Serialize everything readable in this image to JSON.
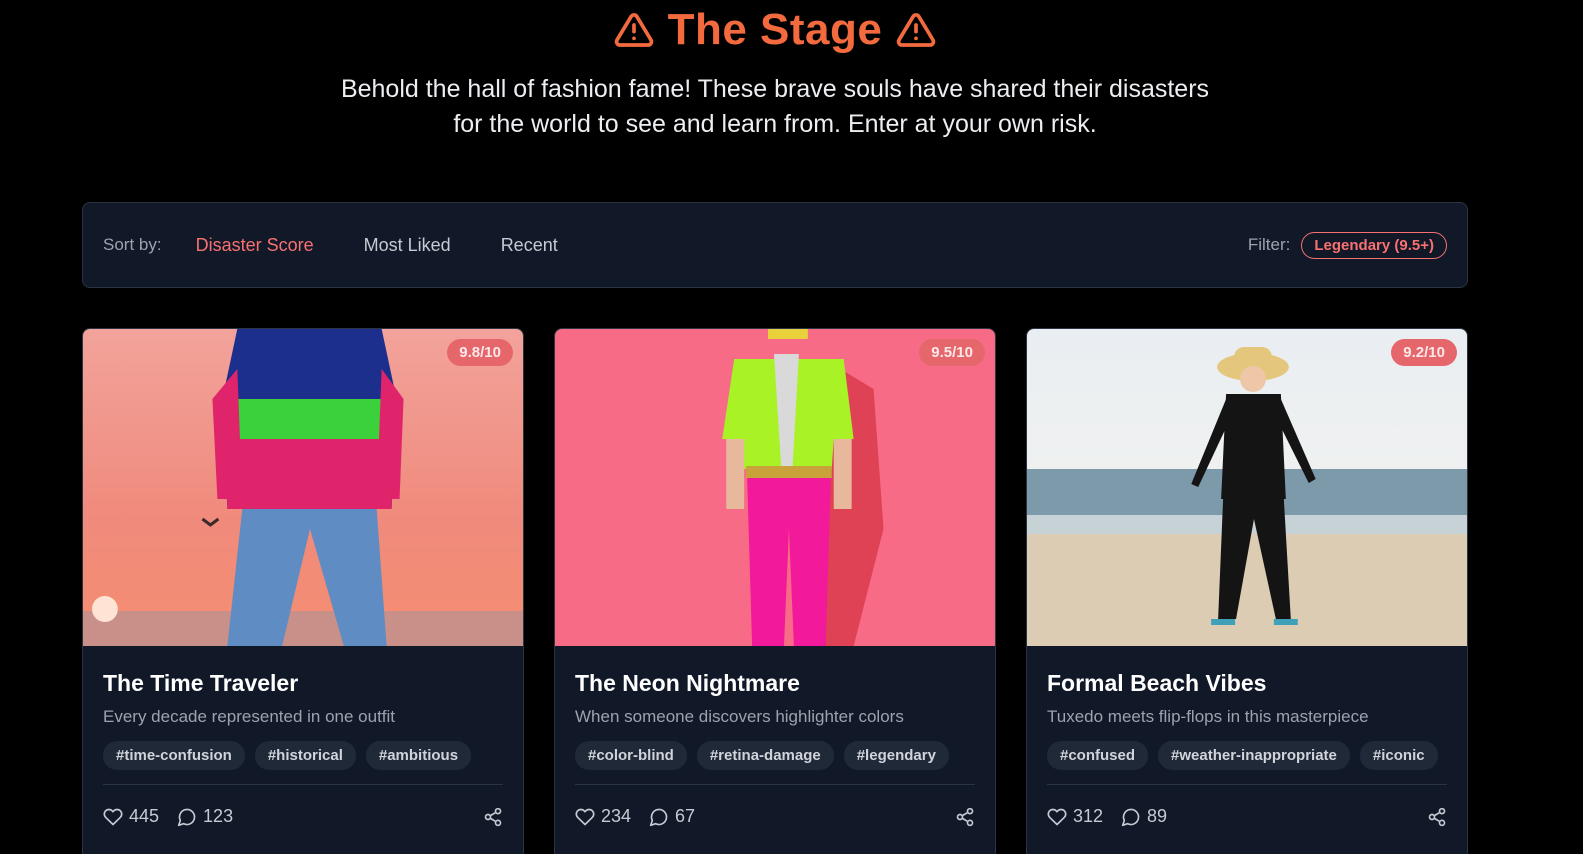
{
  "hero": {
    "title": "The Stage",
    "subtitle_line1": "Behold the hall of fashion fame! These brave souls have shared their disasters",
    "subtitle_line2": "for the world to see and learn from. Enter at your own risk."
  },
  "toolbar": {
    "sort_label": "Sort by:",
    "sort_options": [
      "Disaster Score",
      "Most Liked",
      "Recent"
    ],
    "active_sort": "Disaster Score",
    "filter_label": "Filter:",
    "filter_value": "Legendary (9.5+)"
  },
  "colors": {
    "accent": "#f87171",
    "title_orange": "#f36a3f",
    "card_bg": "#111827",
    "page_bg": "#000000"
  },
  "cards": [
    {
      "score": "9.8/10",
      "title": "The Time Traveler",
      "description": "Every decade represented in one outfit",
      "tags": [
        "#time-confusion",
        "#historical",
        "#ambitious"
      ],
      "likes": "445",
      "comments": "123"
    },
    {
      "score": "9.5/10",
      "title": "The Neon Nightmare",
      "description": "When someone discovers highlighter colors",
      "tags": [
        "#color-blind",
        "#retina-damage",
        "#legendary"
      ],
      "likes": "234",
      "comments": "67"
    },
    {
      "score": "9.2/10",
      "title": "Formal Beach Vibes",
      "description": "Tuxedo meets flip-flops in this masterpiece",
      "tags": [
        "#confused",
        "#weather-inappropriate",
        "#iconic"
      ],
      "likes": "312",
      "comments": "89"
    }
  ],
  "icons": {
    "title_icon": "warning-triangle-icon",
    "like_icon": "heart-icon",
    "comment_icon": "comment-bubble-icon",
    "share_icon": "share-icon"
  }
}
